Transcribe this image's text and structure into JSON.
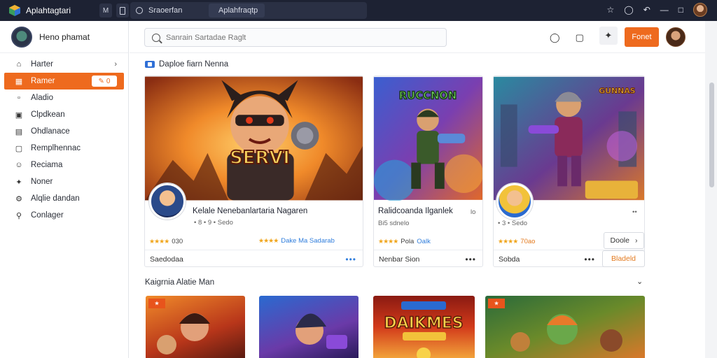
{
  "app": {
    "name": "Aplahtagtari"
  },
  "titlebar": {
    "btn_a": "M",
    "address_left": "Sraoerfan",
    "address_right": "Aplahfraqtp"
  },
  "sidebar": {
    "profile_name": "Heno phamat",
    "items": [
      {
        "label": "Harter",
        "icon": "home-icon"
      },
      {
        "label": "Ramer",
        "icon": "gamepad-icon",
        "badge": "0"
      },
      {
        "label": "Aladio",
        "icon": "audio-icon"
      },
      {
        "label": "Clpdkean",
        "icon": "download-icon"
      },
      {
        "label": "Ohdlanace",
        "icon": "library-icon"
      },
      {
        "label": "Remplhennac",
        "icon": "window-icon"
      },
      {
        "label": "Reciama",
        "icon": "user-icon"
      },
      {
        "label": "Noner",
        "icon": "puzzle-icon"
      },
      {
        "label": "Alqlie dandan",
        "icon": "gear-icon"
      },
      {
        "label": "Conlager",
        "icon": "search-icon"
      }
    ]
  },
  "header": {
    "search_placeholder": "Sanrain Sartadae Raglt",
    "cta_label": "Fonet"
  },
  "section1": {
    "title": "Daploe fiarn Nenna"
  },
  "section2": {
    "title": "Kaigrnia Alatie Man"
  },
  "cards": [
    {
      "title": "Kelale Nenebanlartaria Nagaren",
      "meta": "• 8 • 9 • Sedo",
      "rating": "030",
      "footer": "Saedodaa",
      "art_text": "SERVI"
    },
    {
      "title": "Ralidcoanda Ilganlek",
      "meta": "Bi5 sdnelo",
      "title_suffix": "lo",
      "rating": "Pola",
      "rating_extra": "Oalk",
      "footer": "Nenbar Sion",
      "art_text": "RUCCNON"
    },
    {
      "title": "",
      "meta": "• 3 • Sedo",
      "rating": "70ao",
      "footer": "Sobda",
      "art_text": "GUNNAS"
    }
  ],
  "card_mid_rating": "Dake Ma Sadarab",
  "side_buttons": {
    "details": "Doole",
    "download": "Bladeld"
  },
  "tiles": [
    {
      "label": ""
    },
    {
      "label": ""
    },
    {
      "label": "DAIKMES"
    },
    {
      "label": ""
    }
  ]
}
